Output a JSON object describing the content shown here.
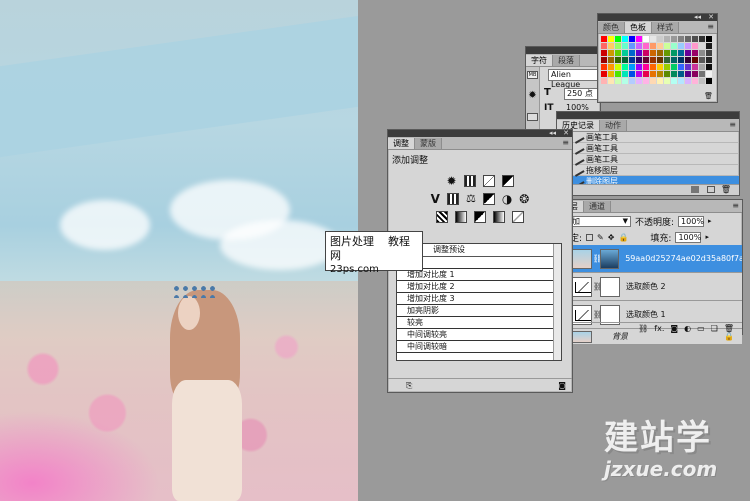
{
  "watermark_label": {
    "line1": "图片处理",
    "line1b": "教程网",
    "line2": "23ps.com"
  },
  "site_watermark": {
    "big": "建站学",
    "small": "jzxue.com"
  },
  "character_panel": {
    "tabs": [
      "字符",
      "段落"
    ],
    "font": "Alien League",
    "size": "250 点",
    "scale_v": "100%",
    "scale_h": "100%"
  },
  "swatches_panel": {
    "tabs": [
      "颜色",
      "色板",
      "样式"
    ],
    "active_tab": "色板",
    "colors": [
      "#ff0000",
      "#ffff00",
      "#00ff00",
      "#00ffff",
      "#0000ff",
      "#ff00ff",
      "#ffffff",
      "#e6e6e6",
      "#cccccc",
      "#b3b3b3",
      "#999999",
      "#808080",
      "#666666",
      "#4d4d4d",
      "#333333",
      "#000000",
      "#ff6666",
      "#ffcc66",
      "#99ff66",
      "#66ffcc",
      "#6699ff",
      "#cc66ff",
      "#ff66cc",
      "#ff9966",
      "#ffcc99",
      "#ccff99",
      "#99ffcc",
      "#99ccff",
      "#cc99ff",
      "#ff99cc",
      "#d9d9d9",
      "#1a1a1a",
      "#cc0000",
      "#cc9900",
      "#66cc00",
      "#00cc99",
      "#0066cc",
      "#6600cc",
      "#cc0066",
      "#cc6600",
      "#996600",
      "#669900",
      "#009966",
      "#006699",
      "#660099",
      "#990066",
      "#8c8c8c",
      "#404040",
      "#990000",
      "#996600",
      "#336600",
      "#006633",
      "#003399",
      "#330066",
      "#660033",
      "#993300",
      "#663300",
      "#336633",
      "#006666",
      "#003366",
      "#330033",
      "#660000",
      "#595959",
      "#262626",
      "#ff3300",
      "#ff9900",
      "#ccff00",
      "#00ff99",
      "#0099ff",
      "#9900ff",
      "#ff0099",
      "#ff6600",
      "#ffcc00",
      "#99cc00",
      "#00cc66",
      "#3366ff",
      "#6633cc",
      "#cc3399",
      "#a6a6a6",
      "#0d0d0d",
      "#e60000",
      "#e6b800",
      "#4de600",
      "#00e6b8",
      "#004de6",
      "#b800e6",
      "#e6004d",
      "#e67300",
      "#b38600",
      "#5c8a00",
      "#008a5c",
      "#005c8a",
      "#5c008a",
      "#8a005c",
      "#737373",
      "#f2f2f2",
      "#ffb3b3",
      "#ffe6b3",
      "#ccffb3",
      "#b3ffe6",
      "#b3ccff",
      "#e6b3ff",
      "#ffb3e6",
      "#ffd9b3",
      "#fff2b3",
      "#e6ffb3",
      "#b3fff2",
      "#b3e6ff",
      "#d9b3ff",
      "#ffb3d9",
      "#bfbfbf",
      "#000000"
    ]
  },
  "adjustments_panel": {
    "tabs": [
      "调整",
      "蒙版"
    ],
    "title": "添加调整",
    "preset_header": "调整预设",
    "presets": [
      "较暗",
      "增加对比度 1",
      "增加对比度 2",
      "增加对比度 3",
      "加亮阴影",
      "较亮",
      "中间调较亮",
      "中间调较暗"
    ]
  },
  "history_panel": {
    "tabs": [
      "历史记录",
      "动作"
    ],
    "items": [
      "画笔工具",
      "画笔工具",
      "画笔工具",
      "拖移图层",
      "删除图层"
    ],
    "selected_index": 4
  },
  "layers_panel": {
    "tabs": [
      "图层",
      "通道"
    ],
    "blend_mode": "叠加",
    "opacity_label": "不透明度:",
    "opacity": "100%",
    "lock_label": "锁定:",
    "fill_label": "填充:",
    "fill": "100%",
    "layers": [
      {
        "name": "59aa0d25274ae02d35a80f7a",
        "selected": true
      },
      {
        "name": "选取颜色 2",
        "selected": false
      },
      {
        "name": "选取颜色 1",
        "selected": false
      },
      {
        "name": "背景",
        "selected": false
      }
    ],
    "footer_icons": [
      "link-icon",
      "fx-icon",
      "mask-icon",
      "adjustment-icon",
      "folder-icon",
      "new-layer-icon",
      "trash-icon"
    ]
  }
}
